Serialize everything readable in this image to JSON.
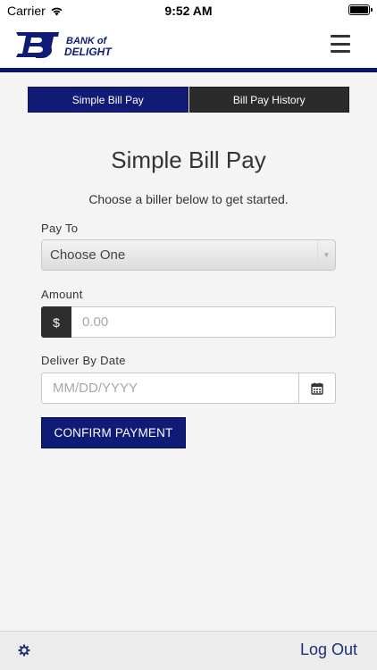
{
  "status_bar": {
    "carrier": "Carrier",
    "time": "9:52 AM"
  },
  "header": {
    "logo_line1": "BANK of",
    "logo_line2": "DELIGHT",
    "brand_color": "#0f1b75"
  },
  "tabs": [
    {
      "label": "Simple Bill Pay",
      "active": true
    },
    {
      "label": "Bill Pay History",
      "active": false
    }
  ],
  "main": {
    "title": "Simple Bill Pay",
    "subtitle": "Choose a biller below to get started.",
    "pay_to_label": "Pay To",
    "pay_to_value": "Choose One",
    "amount_label": "Amount",
    "amount_prefix": "$",
    "amount_placeholder": "0.00",
    "date_label": "Deliver By Date",
    "date_placeholder": "MM/DD/YYYY",
    "confirm_label": "CONFIRM PAYMENT"
  },
  "footer": {
    "logout_label": "Log Out"
  },
  "icons": {
    "wifi": "wifi-icon",
    "battery": "battery-icon",
    "menu": "hamburger-menu-icon",
    "calendar": "calendar-icon",
    "settings": "gear-icon"
  }
}
